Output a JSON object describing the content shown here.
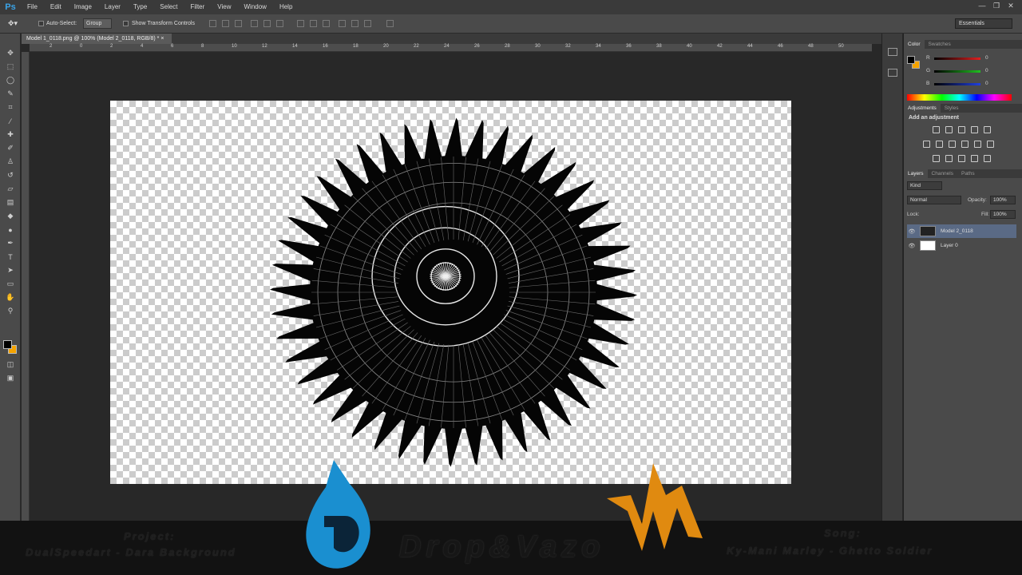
{
  "app": {
    "logo": "Ps"
  },
  "menu": [
    "File",
    "Edit",
    "Image",
    "Layer",
    "Type",
    "Select",
    "Filter",
    "View",
    "Window",
    "Help"
  ],
  "window_controls": [
    "—",
    "❐",
    "✕"
  ],
  "options": {
    "auto_select_label": "Auto-Select:",
    "auto_select_value": "Group",
    "transform_label": "Show Transform Controls",
    "workspace": "Essentials"
  },
  "document": {
    "tab_title": "Model 1_0118.png @ 100% (Model 2_0118, RGB/8) *"
  },
  "ruler_ticks": [
    "2",
    "0",
    "2",
    "4",
    "6",
    "8",
    "10",
    "12",
    "14",
    "16",
    "18",
    "20",
    "22",
    "24",
    "26",
    "28",
    "30",
    "32",
    "34",
    "36",
    "38",
    "40",
    "42",
    "44",
    "46",
    "48",
    "50"
  ],
  "color_panel": {
    "tabs": [
      "Color",
      "Swatches"
    ],
    "channels": [
      {
        "label": "R",
        "value": "0",
        "color": "#e03030"
      },
      {
        "label": "G",
        "value": "0",
        "color": "#30c030"
      },
      {
        "label": "B",
        "value": "0",
        "color": "#3050e0"
      }
    ],
    "fg_color": "#000000",
    "bg_color": "#f5a300"
  },
  "adjustments_panel": {
    "tabs": [
      "Adjustments",
      "Styles"
    ],
    "heading": "Add an adjustment"
  },
  "layers_panel": {
    "tabs": [
      "Layers",
      "Channels",
      "Paths"
    ],
    "kind": "Kind",
    "blend_mode": "Normal",
    "opacity_label": "Opacity:",
    "opacity_value": "100%",
    "lock_label": "Lock:",
    "fill_label": "Fill:",
    "fill_value": "100%",
    "layers": [
      {
        "name": "Model 2_0118",
        "selected": true
      },
      {
        "name": "Layer 0",
        "selected": false
      }
    ]
  },
  "footer": {
    "project_label": "Project:",
    "project_name": "DualSpeedart - Dara Background",
    "brand": "Drop&Vazo",
    "song_label": "Song:",
    "song_name": "Ky-Mani Marley - Ghetto Soldier"
  }
}
